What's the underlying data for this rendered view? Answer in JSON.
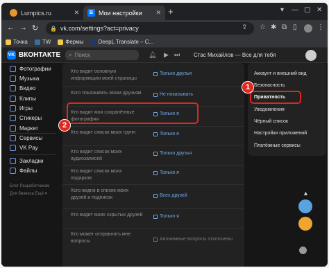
{
  "browser": {
    "tabs": [
      {
        "title": "Lumpics.ru",
        "close": "✕"
      },
      {
        "title": "Мои настройки",
        "close": "✕"
      }
    ],
    "new_tab": "+",
    "window_controls": [
      "▾",
      "—",
      "▢",
      "✕"
    ],
    "url": "vk.com/settings?act=privacy",
    "bookmarks": [
      "Точка",
      "TW",
      "Фермы",
      "DeepL Translate – С..."
    ]
  },
  "vk": {
    "logo_text": "ВКОНТАКТЕ",
    "search_placeholder": "Поиск",
    "header_user": "Стас Михайлов — Все для тебя",
    "nav": [
      "Фотографии",
      "Музыка",
      "Видео",
      "Клипы",
      "Игры",
      "Стикеры",
      "Маркет",
      "Сервисы",
      "VK Pay",
      "Закладки",
      "Файлы"
    ],
    "footer": [
      "Блог  Разработчикам",
      "Для бизнеса  Ещё ▾"
    ]
  },
  "privacy_rows": [
    {
      "question": "Кто видит основную информацию моей страницы",
      "answer": "Только друзья",
      "muted": false
    },
    {
      "question": "Кого показывать моим друзьям",
      "answer": "Не показывать",
      "muted": false
    },
    {
      "question": "Кто видит мои сохранённые фотографии",
      "answer": "Только я",
      "muted": false
    },
    {
      "question": "Кто видит список моих групп",
      "answer": "Только я",
      "muted": false
    },
    {
      "question": "Кто видит список моих аудиозаписей",
      "answer": "Только друзья",
      "muted": false
    },
    {
      "question": "Кто видит список моих подарков",
      "answer": "Только я",
      "muted": false
    },
    {
      "question": "Кого видно в списке моих друзей и подписок",
      "answer": "Всех друзей",
      "muted": false
    },
    {
      "question": "Кто видит моих скрытых друзей",
      "answer": "Только я",
      "muted": false
    },
    {
      "question": "Кто может отправлять мне вопросы",
      "answer": "Анонимные вопросы отключены",
      "muted": true
    }
  ],
  "settings_menu": [
    "Аккаунт и внешний вид",
    "Безопасность",
    "Приватность",
    "Уведомления",
    "Чёрный список",
    "Настройки приложений",
    "Платёжные сервисы"
  ],
  "annotations": [
    "1",
    "2"
  ]
}
